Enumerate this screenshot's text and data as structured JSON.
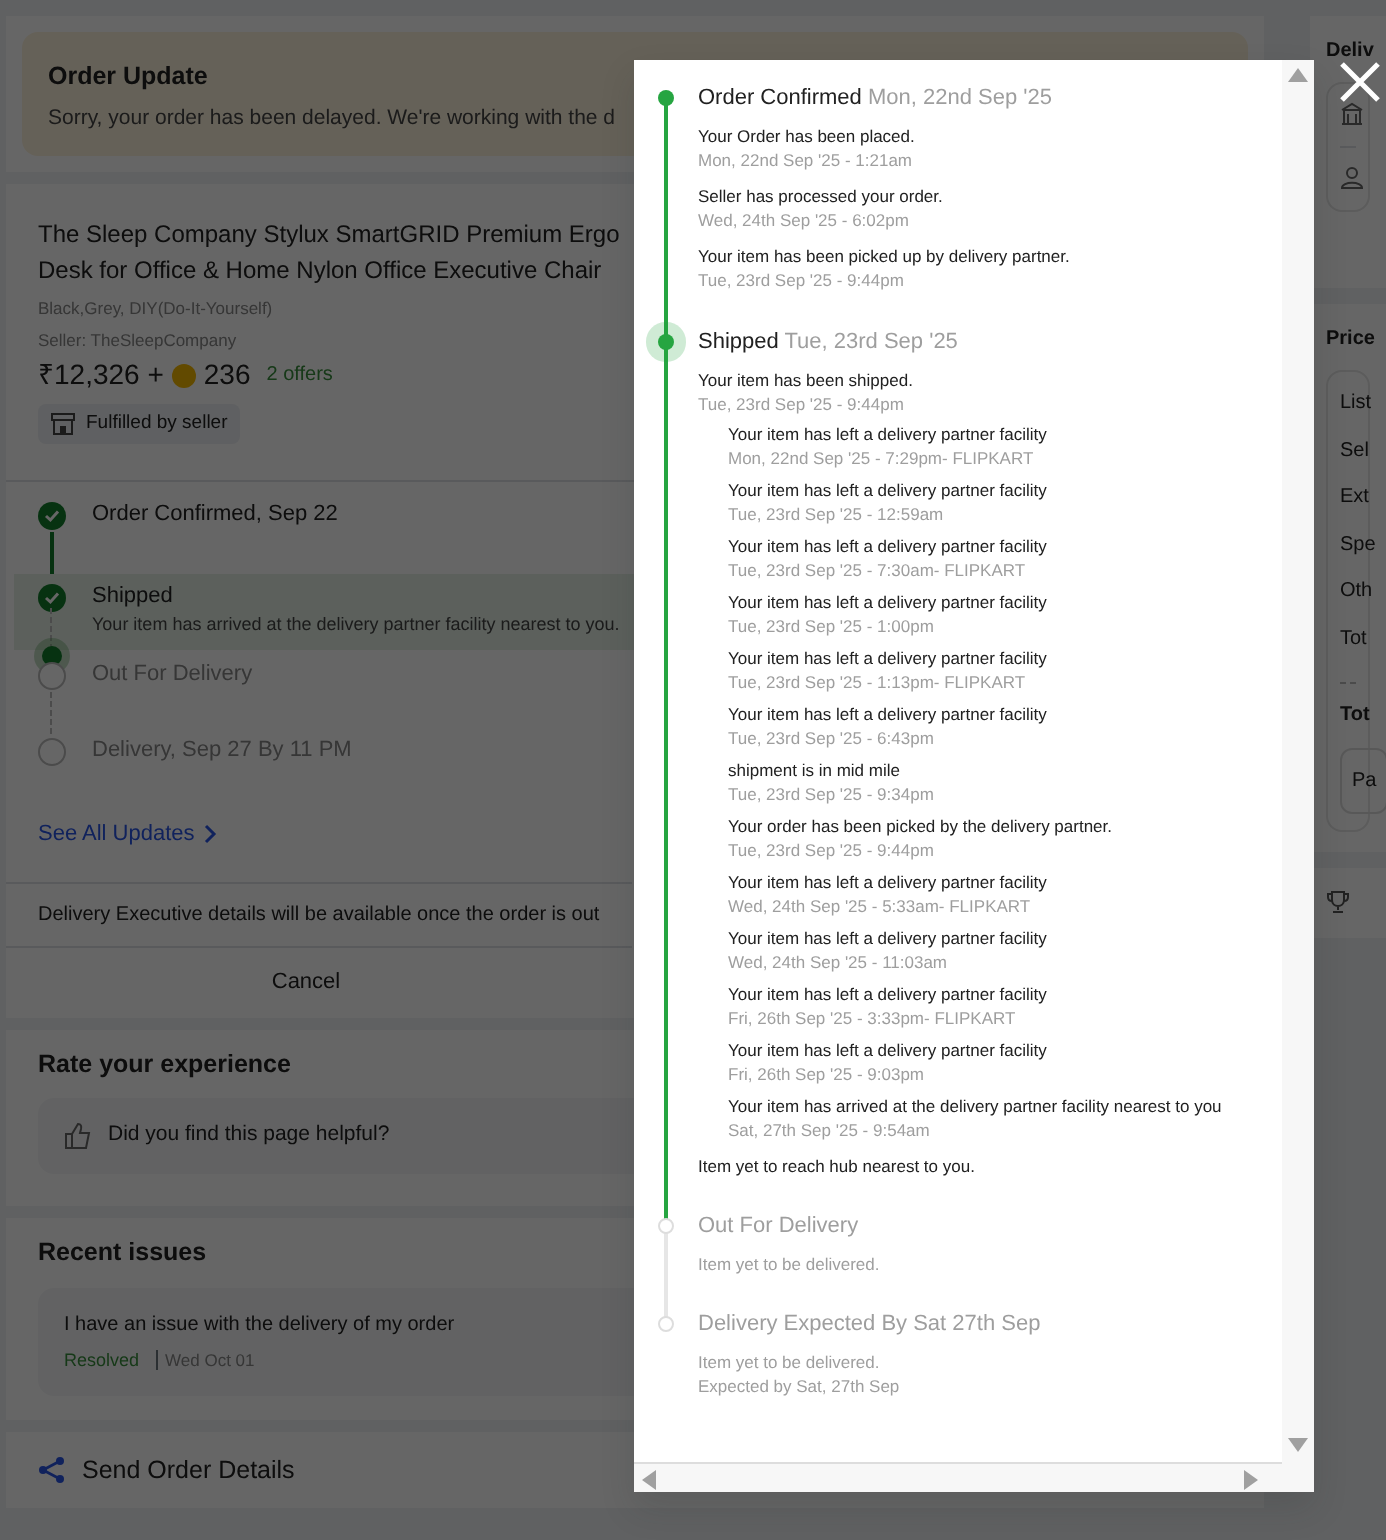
{
  "order_update": {
    "title": "Order Update",
    "message": "Sorry, your order has been delayed. We're working with the d"
  },
  "product": {
    "title_lines": [
      "The Sleep Company Stylux SmartGRID Premium Ergo",
      "Desk for Office & Home Nylon Office Executive Chair"
    ],
    "variant": "Black,Grey, DIY(Do-It-Yourself)",
    "seller": "Seller: TheSleepCompany",
    "price": "₹12,326 +",
    "coins": "236",
    "offers": "2 offers",
    "fulfilment": "Fulfilled by seller"
  },
  "progress": [
    {
      "label": "Order Confirmed, Sep 22",
      "completed": true,
      "current": false
    },
    {
      "label": "Shipped",
      "completed": true,
      "current": true,
      "detail": "Your item has arrived at the delivery partner facility nearest to you."
    },
    {
      "label": "Out For Delivery",
      "completed": false,
      "current": false
    },
    {
      "label": "Delivery, Sep 27 By 11 PM",
      "completed": false,
      "current": false
    }
  ],
  "see_all": "See All Updates",
  "delivery_exec_note": "Delivery Executive details will be available once the order is out",
  "cancel": "Cancel",
  "feedback": {
    "title": "Rate your experience",
    "question": "Did you find this page helpful?"
  },
  "recent_issues": {
    "title": "Recent issues",
    "items": [
      {
        "text": "I have an issue with the delivery of my order",
        "status": "Resolved",
        "date": "Wed Oct 01"
      }
    ]
  },
  "share": "Send Order Details",
  "side": {
    "delivery_title": "Deliv",
    "price_title": "Price",
    "price_rows": [
      "List",
      "Sel",
      "Ext",
      "Spe",
      "Oth",
      "Tot"
    ],
    "total": "Tot",
    "pay": "Pa"
  },
  "modal": {
    "stages": [
      {
        "title": "Order Confirmed",
        "date": "Mon, 22nd Sep '25",
        "completed": true,
        "current": false,
        "events": [
          {
            "text": "Your Order has been placed.",
            "time": "Mon, 22nd Sep '25 - 1:21am"
          },
          {
            "text": "Seller has processed your order.",
            "time": "Wed, 24th Sep '25 - 6:02pm"
          },
          {
            "text": "Your item has been picked up by delivery partner.",
            "time": "Tue, 23rd Sep '25 - 9:44pm"
          }
        ]
      },
      {
        "title": "Shipped",
        "date": "Tue, 23rd Sep '25",
        "completed": true,
        "current": true,
        "events": [
          {
            "text": "Your item has been shipped.",
            "time": "Tue, 23rd Sep '25 - 9:44pm",
            "children": [
              {
                "text": "Your item has left a delivery partner facility",
                "time": "Mon, 22nd Sep '25 - 7:29pm- FLIPKART"
              },
              {
                "text": "Your item has left a delivery partner facility",
                "time": "Tue, 23rd Sep '25 - 12:59am"
              },
              {
                "text": "Your item has left a delivery partner facility",
                "time": "Tue, 23rd Sep '25 - 7:30am- FLIPKART"
              },
              {
                "text": "Your item has left a delivery partner facility",
                "time": "Tue, 23rd Sep '25 - 1:00pm"
              },
              {
                "text": "Your item has left a delivery partner facility",
                "time": "Tue, 23rd Sep '25 - 1:13pm- FLIPKART"
              },
              {
                "text": "Your item has left a delivery partner facility",
                "time": "Tue, 23rd Sep '25 - 6:43pm"
              },
              {
                "text": "shipment is in mid mile",
                "time": "Tue, 23rd Sep '25 - 9:34pm"
              },
              {
                "text": "Your order has been picked by the delivery partner.",
                "time": "Tue, 23rd Sep '25 - 9:44pm"
              },
              {
                "text": "Your item has left a delivery partner facility",
                "time": "Wed, 24th Sep '25 - 5:33am- FLIPKART"
              },
              {
                "text": "Your item has left a delivery partner facility",
                "time": "Wed, 24th Sep '25 - 11:03am"
              },
              {
                "text": "Your item has left a delivery partner facility",
                "time": "Fri, 26th Sep '25 - 3:33pm- FLIPKART"
              },
              {
                "text": "Your item has left a delivery partner facility",
                "time": "Fri, 26th Sep '25 - 9:03pm"
              },
              {
                "text": "Your item has arrived at the delivery partner facility nearest to you",
                "time": "Sat, 27th Sep '25 - 9:54am"
              }
            ]
          },
          {
            "text": "Item yet to reach hub nearest to you."
          }
        ]
      },
      {
        "title": "Out For Delivery",
        "completed": false,
        "current": false,
        "events": [
          {
            "text": "Item yet to be delivered."
          }
        ]
      },
      {
        "title": "Delivery Expected By Sat 27th Sep",
        "completed": false,
        "current": false,
        "events": [
          {
            "text": "Item yet to be delivered.",
            "time": "Expected by Sat, 27th Sep"
          }
        ]
      }
    ]
  }
}
